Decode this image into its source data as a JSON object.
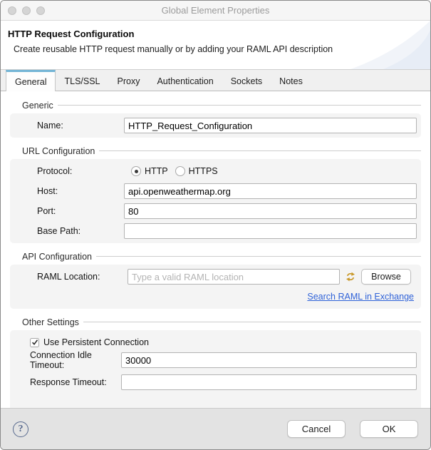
{
  "window": {
    "title": "Global Element Properties"
  },
  "header": {
    "title": "HTTP Request Configuration",
    "subtitle": "Create reusable HTTP request manually or by adding your RAML API description"
  },
  "tabs": [
    {
      "label": "General",
      "active": true
    },
    {
      "label": "TLS/SSL",
      "active": false
    },
    {
      "label": "Proxy",
      "active": false
    },
    {
      "label": "Authentication",
      "active": false
    },
    {
      "label": "Sockets",
      "active": false
    },
    {
      "label": "Notes",
      "active": false
    }
  ],
  "sections": {
    "generic": {
      "title": "Generic",
      "name_label": "Name:",
      "name_value": "HTTP_Request_Configuration"
    },
    "url": {
      "title": "URL Configuration",
      "protocol_label": "Protocol:",
      "protocol_options": [
        {
          "label": "HTTP",
          "selected": true
        },
        {
          "label": "HTTPS",
          "selected": false
        }
      ],
      "host_label": "Host:",
      "host_value": "api.openweathermap.org",
      "port_label": "Port:",
      "port_value": "80",
      "base_path_label": "Base Path:",
      "base_path_value": ""
    },
    "api": {
      "title": "API Configuration",
      "raml_label": "RAML Location:",
      "raml_value": "",
      "raml_placeholder": "Type a valid RAML location",
      "refresh_icon": "refresh-raml-icon",
      "browse_label": "Browse",
      "link_label": "Search RAML in Exchange"
    },
    "other": {
      "title": "Other Settings",
      "persistent_label": "Use Persistent Connection",
      "persistent_checked": true,
      "idle_label": "Connection Idle Timeout:",
      "idle_value": "30000",
      "response_label": "Response Timeout:",
      "response_value": ""
    }
  },
  "footer": {
    "help_label": "?",
    "cancel_label": "Cancel",
    "ok_label": "OK"
  },
  "colors": {
    "tab_accent": "#74b5d6",
    "link": "#2f62d8",
    "raml_refresh_icon": "#c9992b",
    "help_icon": "#56688d",
    "panel_bg": "#f4f4f4",
    "footer_bg": "#e3e3e3"
  }
}
